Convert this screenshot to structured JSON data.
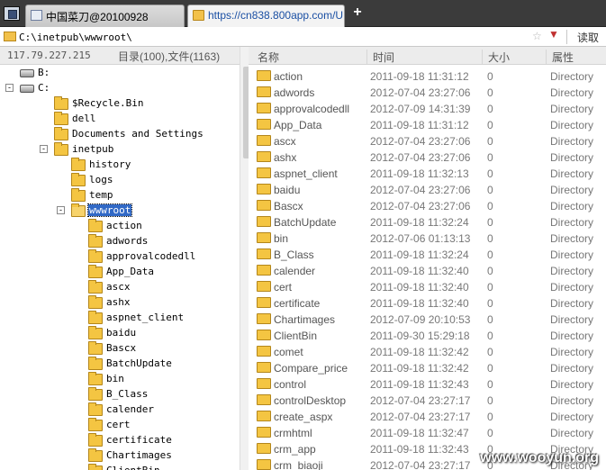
{
  "tabs": [
    {
      "title": "中国菜刀@20100928",
      "active": false
    },
    {
      "title": "https://cn838.800app.com/U...",
      "active": true
    }
  ],
  "new_tab_label": "+",
  "address": {
    "value": "C:\\inetpub\\wwwroot\\",
    "star": "☆",
    "dropdown": "▼",
    "read_label": "读取"
  },
  "left_header": {
    "ip": "117.79.227.215",
    "counts": "目录(100),文件(1163)"
  },
  "tree": [
    {
      "label": "B:",
      "icon": "drive-icon",
      "depth": 0,
      "toggle": "",
      "selected": false
    },
    {
      "label": "C:",
      "icon": "drive-icon",
      "depth": 0,
      "toggle": "-",
      "selected": false
    },
    {
      "label": "$Recycle.Bin",
      "icon": "folder-icon",
      "depth": 1,
      "toggle": "",
      "selected": false
    },
    {
      "label": "dell",
      "icon": "folder-icon",
      "depth": 1,
      "toggle": "",
      "selected": false
    },
    {
      "label": "Documents and Settings",
      "icon": "folder-icon",
      "depth": 1,
      "toggle": "",
      "selected": false
    },
    {
      "label": "inetpub",
      "icon": "folder-icon",
      "depth": 1,
      "toggle": "-",
      "selected": false
    },
    {
      "label": "history",
      "icon": "folder-icon",
      "depth": 2,
      "toggle": "",
      "selected": false
    },
    {
      "label": "logs",
      "icon": "folder-icon",
      "depth": 2,
      "toggle": "",
      "selected": false
    },
    {
      "label": "temp",
      "icon": "folder-icon",
      "depth": 2,
      "toggle": "",
      "selected": false
    },
    {
      "label": "wwwroot",
      "icon": "folder-open-icon",
      "depth": 2,
      "toggle": "-",
      "selected": true
    },
    {
      "label": "action",
      "icon": "folder-icon",
      "depth": 3,
      "toggle": "",
      "selected": false
    },
    {
      "label": "adwords",
      "icon": "folder-icon",
      "depth": 3,
      "toggle": "",
      "selected": false
    },
    {
      "label": "approvalcodedll",
      "icon": "folder-icon",
      "depth": 3,
      "toggle": "",
      "selected": false
    },
    {
      "label": "App_Data",
      "icon": "folder-icon",
      "depth": 3,
      "toggle": "",
      "selected": false
    },
    {
      "label": "ascx",
      "icon": "folder-icon",
      "depth": 3,
      "toggle": "",
      "selected": false
    },
    {
      "label": "ashx",
      "icon": "folder-icon",
      "depth": 3,
      "toggle": "",
      "selected": false
    },
    {
      "label": "aspnet_client",
      "icon": "folder-icon",
      "depth": 3,
      "toggle": "",
      "selected": false
    },
    {
      "label": "baidu",
      "icon": "folder-icon",
      "depth": 3,
      "toggle": "",
      "selected": false
    },
    {
      "label": "Bascx",
      "icon": "folder-icon",
      "depth": 3,
      "toggle": "",
      "selected": false
    },
    {
      "label": "BatchUpdate",
      "icon": "folder-icon",
      "depth": 3,
      "toggle": "",
      "selected": false
    },
    {
      "label": "bin",
      "icon": "folder-icon",
      "depth": 3,
      "toggle": "",
      "selected": false
    },
    {
      "label": "B_Class",
      "icon": "folder-icon",
      "depth": 3,
      "toggle": "",
      "selected": false
    },
    {
      "label": "calender",
      "icon": "folder-icon",
      "depth": 3,
      "toggle": "",
      "selected": false
    },
    {
      "label": "cert",
      "icon": "folder-icon",
      "depth": 3,
      "toggle": "",
      "selected": false
    },
    {
      "label": "certificate",
      "icon": "folder-icon",
      "depth": 3,
      "toggle": "",
      "selected": false
    },
    {
      "label": "Chartimages",
      "icon": "folder-icon",
      "depth": 3,
      "toggle": "",
      "selected": false
    },
    {
      "label": "ClientBin",
      "icon": "folder-icon",
      "depth": 3,
      "toggle": "",
      "selected": false
    }
  ],
  "columns": {
    "name": "名称",
    "time": "时间",
    "size": "大小",
    "attr": "属性"
  },
  "files": [
    {
      "name": "action",
      "time": "2011-09-18 11:31:12",
      "size": "0",
      "attr": "Directory"
    },
    {
      "name": "adwords",
      "time": "2012-07-04 23:27:06",
      "size": "0",
      "attr": "Directory"
    },
    {
      "name": "approvalcodedll",
      "time": "2012-07-09 14:31:39",
      "size": "0",
      "attr": "Directory"
    },
    {
      "name": "App_Data",
      "time": "2011-09-18 11:31:12",
      "size": "0",
      "attr": "Directory"
    },
    {
      "name": "ascx",
      "time": "2012-07-04 23:27:06",
      "size": "0",
      "attr": "Directory"
    },
    {
      "name": "ashx",
      "time": "2012-07-04 23:27:06",
      "size": "0",
      "attr": "Directory"
    },
    {
      "name": "aspnet_client",
      "time": "2011-09-18 11:32:13",
      "size": "0",
      "attr": "Directory"
    },
    {
      "name": "baidu",
      "time": "2012-07-04 23:27:06",
      "size": "0",
      "attr": "Directory"
    },
    {
      "name": "Bascx",
      "time": "2012-07-04 23:27:06",
      "size": "0",
      "attr": "Directory"
    },
    {
      "name": "BatchUpdate",
      "time": "2011-09-18 11:32:24",
      "size": "0",
      "attr": "Directory"
    },
    {
      "name": "bin",
      "time": "2012-07-06 01:13:13",
      "size": "0",
      "attr": "Directory"
    },
    {
      "name": "B_Class",
      "time": "2011-09-18 11:32:24",
      "size": "0",
      "attr": "Directory"
    },
    {
      "name": "calender",
      "time": "2011-09-18 11:32:40",
      "size": "0",
      "attr": "Directory"
    },
    {
      "name": "cert",
      "time": "2011-09-18 11:32:40",
      "size": "0",
      "attr": "Directory"
    },
    {
      "name": "certificate",
      "time": "2011-09-18 11:32:40",
      "size": "0",
      "attr": "Directory"
    },
    {
      "name": "Chartimages",
      "time": "2012-07-09 20:10:53",
      "size": "0",
      "attr": "Directory"
    },
    {
      "name": "ClientBin",
      "time": "2011-09-30 15:29:18",
      "size": "0",
      "attr": "Directory"
    },
    {
      "name": "comet",
      "time": "2011-09-18 11:32:42",
      "size": "0",
      "attr": "Directory"
    },
    {
      "name": "Compare_price",
      "time": "2011-09-18 11:32:42",
      "size": "0",
      "attr": "Directory"
    },
    {
      "name": "control",
      "time": "2011-09-18 11:32:43",
      "size": "0",
      "attr": "Directory"
    },
    {
      "name": "controlDesktop",
      "time": "2012-07-04 23:27:17",
      "size": "0",
      "attr": "Directory"
    },
    {
      "name": "create_aspx",
      "time": "2012-07-04 23:27:17",
      "size": "0",
      "attr": "Directory"
    },
    {
      "name": "crmhtml",
      "time": "2011-09-18 11:32:47",
      "size": "0",
      "attr": "Directory"
    },
    {
      "name": "crm_app",
      "time": "2011-09-18 11:32:43",
      "size": "0",
      "attr": "Directory"
    },
    {
      "name": "crm_biaoji",
      "time": "2012-07-04 23:27:17",
      "size": "0",
      "attr": "Directory"
    }
  ],
  "watermark": "www.wooyun.org"
}
